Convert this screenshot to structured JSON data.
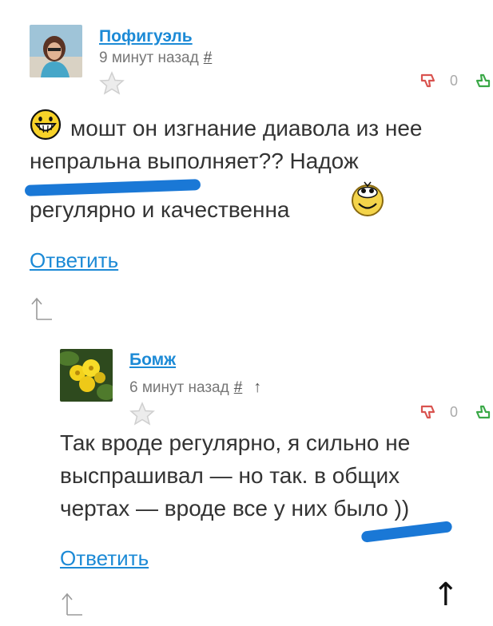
{
  "comments": [
    {
      "author": "Пофигуэль",
      "time": "9 минут назад",
      "hash": "#",
      "rating": "0",
      "text_line1": "мошт он изгнание диавола из нее",
      "text_line2": "непральна выполняет?? Надож",
      "text_line3": "регулярно и качественна",
      "reply_label": "Ответить"
    },
    {
      "author": "Бомж",
      "time": "6 минут назад",
      "hash": "#",
      "parent_arrow": "↑",
      "rating": "0",
      "text_line1": "Так вроде регулярно, я сильно не",
      "text_line2": "выспрашивал — но так. в общих",
      "text_line3": "чертах — вроде все у них было ))",
      "reply_label": "Ответить"
    }
  ],
  "scroll_top_arrow": "↑",
  "colors": {
    "link": "#1c8ad6",
    "thumb_down": "#d9534f",
    "thumb_up": "#3aa847",
    "marker": "#1a78d6"
  },
  "icons": [
    "star-icon",
    "thumb-down-icon",
    "thumb-up-icon",
    "grin-emoji-icon",
    "rolling-eyes-emoji-icon",
    "reply-return-icon",
    "up-arrow-icon"
  ]
}
